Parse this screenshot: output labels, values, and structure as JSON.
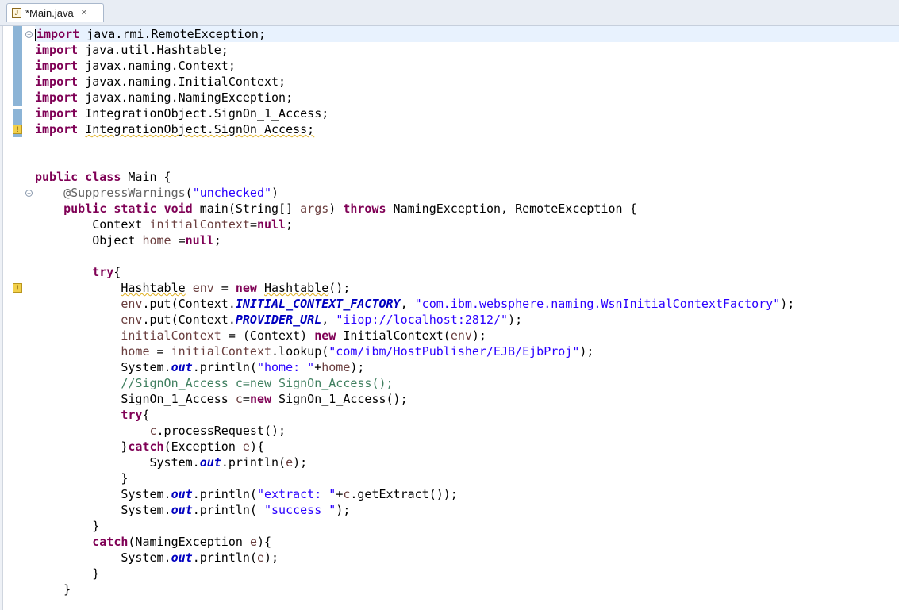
{
  "editor_tab": {
    "title": "*Main.java",
    "icon": "java-file-icon",
    "close_glyph": "✕"
  },
  "colors": {
    "keyword": "#7f0055",
    "string": "#2a00ff",
    "field": "#0000c0",
    "local_var": "#6a3e3e",
    "comment": "#3f7f5f",
    "annotation": "#646464",
    "current_line": "#e8f2fe"
  },
  "code": {
    "lines": [
      [
        [
          "kw",
          "import"
        ],
        [
          "t",
          " java.rmi.RemoteException;"
        ]
      ],
      [
        [
          "kw",
          "import"
        ],
        [
          "t",
          " java.util.Hashtable;"
        ]
      ],
      [
        [
          "kw",
          "import"
        ],
        [
          "t",
          " javax.naming.Context;"
        ]
      ],
      [
        [
          "kw",
          "import"
        ],
        [
          "t",
          " javax.naming.InitialContext;"
        ]
      ],
      [
        [
          "kw",
          "import"
        ],
        [
          "t",
          " javax.naming.NamingException;"
        ]
      ],
      [
        [
          "kw",
          "import"
        ],
        [
          "t",
          " IntegrationObject.SignOn_1_Access;"
        ]
      ],
      [
        [
          "kw",
          "import"
        ],
        [
          "t",
          " "
        ],
        [
          "w",
          "IntegrationObject.SignOn_Access;"
        ]
      ],
      [],
      [],
      [
        [
          "kw",
          "public"
        ],
        [
          "t",
          " "
        ],
        [
          "kw",
          "class"
        ],
        [
          "t",
          " Main {"
        ]
      ],
      [
        [
          "t",
          "    "
        ],
        [
          "ann",
          "@SuppressWarnings"
        ],
        [
          "t",
          "("
        ],
        [
          "str",
          "\"unchecked\""
        ],
        [
          "t",
          ")"
        ]
      ],
      [
        [
          "t",
          "    "
        ],
        [
          "kw",
          "public"
        ],
        [
          "t",
          " "
        ],
        [
          "kw",
          "static"
        ],
        [
          "t",
          " "
        ],
        [
          "kw",
          "void"
        ],
        [
          "t",
          " main(String[] "
        ],
        [
          "var",
          "args"
        ],
        [
          "t",
          ") "
        ],
        [
          "kw",
          "throws"
        ],
        [
          "t",
          " NamingException, RemoteException {"
        ]
      ],
      [
        [
          "t",
          "        Context "
        ],
        [
          "var",
          "initialContext"
        ],
        [
          "t",
          "="
        ],
        [
          "kw",
          "null"
        ],
        [
          "t",
          ";"
        ]
      ],
      [
        [
          "t",
          "        Object "
        ],
        [
          "var",
          "home"
        ],
        [
          "t",
          " ="
        ],
        [
          "kw",
          "null"
        ],
        [
          "t",
          ";"
        ]
      ],
      [],
      [
        [
          "t",
          "        "
        ],
        [
          "kw",
          "try"
        ],
        [
          "t",
          "{"
        ]
      ],
      [
        [
          "t",
          "            "
        ],
        [
          "w",
          "Hashtable"
        ],
        [
          "t",
          " "
        ],
        [
          "var",
          "env"
        ],
        [
          "t",
          " = "
        ],
        [
          "kw",
          "new"
        ],
        [
          "t",
          " "
        ],
        [
          "w",
          "Hashtable"
        ],
        [
          "t",
          "();"
        ]
      ],
      [
        [
          "t",
          "            "
        ],
        [
          "var",
          "env"
        ],
        [
          "t",
          ".put(Context."
        ],
        [
          "fld",
          "INITIAL_CONTEXT_FACTORY"
        ],
        [
          "t",
          ", "
        ],
        [
          "str",
          "\"com.ibm.websphere.naming.WsnInitialContextFactory\""
        ],
        [
          "t",
          ");"
        ]
      ],
      [
        [
          "t",
          "            "
        ],
        [
          "var",
          "env"
        ],
        [
          "t",
          ".put(Context."
        ],
        [
          "fld",
          "PROVIDER_URL"
        ],
        [
          "t",
          ", "
        ],
        [
          "str",
          "\"iiop://localhost:2812/\""
        ],
        [
          "t",
          ");"
        ]
      ],
      [
        [
          "t",
          "            "
        ],
        [
          "var",
          "initialContext"
        ],
        [
          "t",
          " = (Context) "
        ],
        [
          "kw",
          "new"
        ],
        [
          "t",
          " InitialContext("
        ],
        [
          "var",
          "env"
        ],
        [
          "t",
          ");"
        ]
      ],
      [
        [
          "t",
          "            "
        ],
        [
          "var",
          "home"
        ],
        [
          "t",
          " = "
        ],
        [
          "var",
          "initialContext"
        ],
        [
          "t",
          ".lookup("
        ],
        [
          "str",
          "\"com/ibm/HostPublisher/EJB/EjbProj\""
        ],
        [
          "t",
          ");"
        ]
      ],
      [
        [
          "t",
          "            System."
        ],
        [
          "fld",
          "out"
        ],
        [
          "t",
          ".println("
        ],
        [
          "str",
          "\"home: \""
        ],
        [
          "t",
          "+"
        ],
        [
          "var",
          "home"
        ],
        [
          "t",
          ");"
        ]
      ],
      [
        [
          "t",
          "            "
        ],
        [
          "cmt",
          "//SignOn_Access c=new SignOn_Access();"
        ]
      ],
      [
        [
          "t",
          "            SignOn_1_Access "
        ],
        [
          "var",
          "c"
        ],
        [
          "t",
          "="
        ],
        [
          "kw",
          "new"
        ],
        [
          "t",
          " SignOn_1_Access();"
        ]
      ],
      [
        [
          "t",
          "            "
        ],
        [
          "kw",
          "try"
        ],
        [
          "t",
          "{"
        ]
      ],
      [
        [
          "t",
          "                "
        ],
        [
          "var",
          "c"
        ],
        [
          "t",
          ".processRequest();"
        ]
      ],
      [
        [
          "t",
          "            }"
        ],
        [
          "kw",
          "catch"
        ],
        [
          "t",
          "(Exception "
        ],
        [
          "var",
          "e"
        ],
        [
          "t",
          "){"
        ]
      ],
      [
        [
          "t",
          "                System."
        ],
        [
          "fld",
          "out"
        ],
        [
          "t",
          ".println("
        ],
        [
          "var",
          "e"
        ],
        [
          "t",
          ");"
        ]
      ],
      [
        [
          "t",
          "            }"
        ]
      ],
      [
        [
          "t",
          "            System."
        ],
        [
          "fld",
          "out"
        ],
        [
          "t",
          ".println("
        ],
        [
          "str",
          "\"extract: \""
        ],
        [
          "t",
          "+"
        ],
        [
          "var",
          "c"
        ],
        [
          "t",
          ".getExtract());"
        ]
      ],
      [
        [
          "t",
          "            System."
        ],
        [
          "fld",
          "out"
        ],
        [
          "t",
          ".println( "
        ],
        [
          "str",
          "\"success \""
        ],
        [
          "t",
          ");"
        ]
      ],
      [
        [
          "t",
          "        }"
        ]
      ],
      [
        [
          "t",
          "        "
        ],
        [
          "kw",
          "catch"
        ],
        [
          "t",
          "(NamingException "
        ],
        [
          "var",
          "e"
        ],
        [
          "t",
          "){"
        ]
      ],
      [
        [
          "t",
          "            System."
        ],
        [
          "fld",
          "out"
        ],
        [
          "t",
          ".println("
        ],
        [
          "var",
          "e"
        ],
        [
          "t",
          ");"
        ]
      ],
      [
        [
          "t",
          "        }"
        ]
      ],
      [
        [
          "t",
          "    }"
        ]
      ]
    ]
  }
}
